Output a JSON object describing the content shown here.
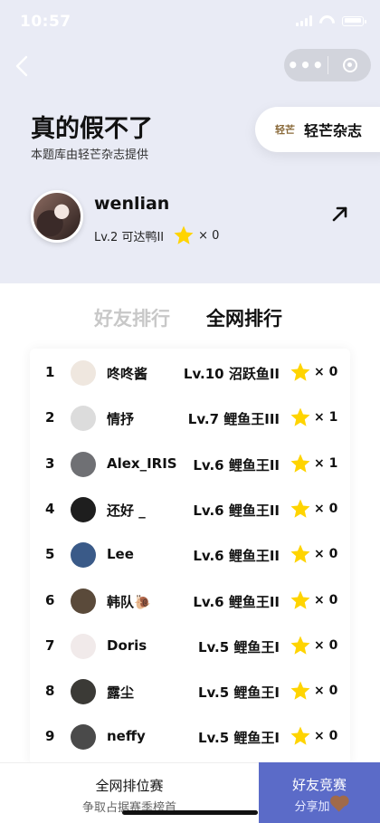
{
  "status": {
    "time": "10:57"
  },
  "header": {
    "title": "真的假不了",
    "subtitle": "本题库由轻芒杂志提供",
    "brand_logo": "轻芒",
    "brand_name": "轻芒杂志",
    "menu_icon": "more-dots-icon",
    "close_icon": "record-icon"
  },
  "user": {
    "name": "wenlian",
    "level": "Lv.2 可达鸭II",
    "stars": "× 0"
  },
  "tabs": {
    "friends": "好友排行",
    "global": "全网排行",
    "active": "global"
  },
  "ranking": [
    {
      "rank": "1",
      "name": "咚咚酱",
      "level": "Lv.10 沼跃鱼II",
      "stars": "× 0",
      "avatar_color": "#efe7df"
    },
    {
      "rank": "2",
      "name": "情抒",
      "level": "Lv.7 鲤鱼王III",
      "stars": "× 1",
      "avatar_color": "#dcdcdc"
    },
    {
      "rank": "3",
      "name": "Alex_IRIS",
      "level": "Lv.6 鲤鱼王II",
      "stars": "× 1",
      "avatar_color": "#6f7074"
    },
    {
      "rank": "4",
      "name": "还好 _",
      "level": "Lv.6 鲤鱼王II",
      "stars": "× 0",
      "avatar_color": "#1e1e1e"
    },
    {
      "rank": "5",
      "name": "Lee",
      "level": "Lv.6 鲤鱼王II",
      "stars": "× 0",
      "avatar_color": "#3a5a88"
    },
    {
      "rank": "6",
      "name": "韩队🐌",
      "level": "Lv.6 鲤鱼王II",
      "stars": "× 0",
      "avatar_color": "#5a4a3a"
    },
    {
      "rank": "7",
      "name": "Doris",
      "level": "Lv.5 鲤鱼王I",
      "stars": "× 0",
      "avatar_color": "#f1eaea"
    },
    {
      "rank": "8",
      "name": "露尘",
      "level": "Lv.5 鲤鱼王I",
      "stars": "× 0",
      "avatar_color": "#3b3a36"
    },
    {
      "rank": "9",
      "name": "neffy",
      "level": "Lv.5 鲤鱼王I",
      "stars": "× 0",
      "avatar_color": "#4a4a4a"
    }
  ],
  "bottom": {
    "left_title": "全网排位赛",
    "left_sub": "争取占据赛季榜首",
    "right_title": "好友竞赛",
    "right_sub": "分享加"
  },
  "colors": {
    "accent": "#5b6bc8",
    "header_bg": "#e9ebf5",
    "star": "#ffd400"
  }
}
